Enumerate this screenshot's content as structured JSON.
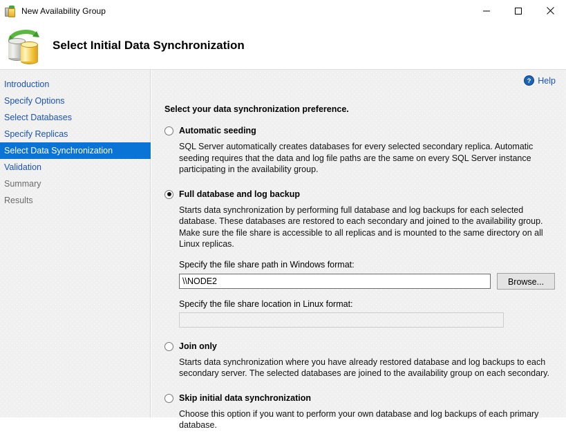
{
  "window": {
    "title": "New Availability Group",
    "icon": "availability-group-icon",
    "controls": {
      "minimize": "minimize-icon",
      "maximize": "maximize-icon",
      "close": "close-icon"
    }
  },
  "header": {
    "title": "Select Initial Data Synchronization",
    "icon": "data-synchronization-icon"
  },
  "sidebar": {
    "items": [
      {
        "label": "Introduction",
        "state": "enabled"
      },
      {
        "label": "Specify Options",
        "state": "enabled"
      },
      {
        "label": "Select Databases",
        "state": "enabled"
      },
      {
        "label": "Specify Replicas",
        "state": "enabled"
      },
      {
        "label": "Select Data Synchronization",
        "state": "selected"
      },
      {
        "label": "Validation",
        "state": "enabled"
      },
      {
        "label": "Summary",
        "state": "disabled"
      },
      {
        "label": "Results",
        "state": "disabled"
      }
    ]
  },
  "content": {
    "help_label": "Help",
    "help_icon": "help-circle-icon",
    "lead": "Select your data synchronization preference.",
    "options": [
      {
        "label": "Automatic seeding",
        "selected": false,
        "description": "SQL Server automatically creates databases for every selected secondary replica. Automatic seeding requires that the data and log file paths are the same on every SQL Server instance participating in the availability group."
      },
      {
        "label": "Full database and log backup",
        "selected": true,
        "description": "Starts data synchronization by performing full database and log backups for each selected database. These databases are restored to each secondary and joined to the availability group. Make sure the file share is accessible to all replicas and is mounted to the same directory on all Linux replicas."
      },
      {
        "label": "Join only",
        "selected": false,
        "description": "Starts data synchronization where you have already restored database and log backups to each secondary server. The selected databases are joined to the availability group on each secondary."
      },
      {
        "label": "Skip initial data synchronization",
        "selected": false,
        "description": "Choose this option if you want to perform your own database and log backups of each primary database."
      }
    ],
    "windows_path": {
      "label": "Specify the file share path in Windows format:",
      "value": "\\\\NODE2",
      "placeholder": ""
    },
    "linux_path": {
      "label": "Specify the file share location in Linux format:",
      "value": "",
      "placeholder": ""
    },
    "browse_label": "Browse..."
  },
  "colors": {
    "accent_blue": "#0a74d6",
    "link_blue": "#1a52b5",
    "body_bg": "#f0f0f0",
    "disabled_text": "#6b6b6b"
  }
}
